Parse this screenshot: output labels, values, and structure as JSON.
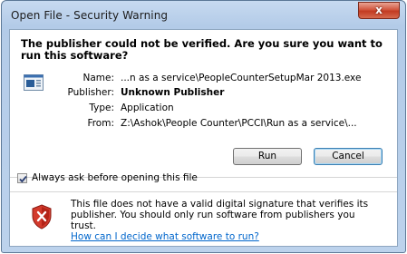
{
  "window": {
    "title": "Open File - Security Warning",
    "close_glyph": "x"
  },
  "headline": "The publisher could not be verified.  Are you sure you want to run this software?",
  "file_icon": "application-file-icon",
  "details": [
    {
      "label": "Name:",
      "value": "...n as a service\\PeopleCounterSetupMar 2013.exe",
      "bold": false
    },
    {
      "label": "Publisher:",
      "value": "Unknown Publisher",
      "bold": true
    },
    {
      "label": "Type:",
      "value": "Application",
      "bold": false
    },
    {
      "label": "From:",
      "value": "Z:\\Ashok\\People Counter\\PCCI\\Run as a service\\...",
      "bold": false
    }
  ],
  "buttons": {
    "run": "Run",
    "cancel": "Cancel"
  },
  "checkbox": {
    "label": "Always ask before opening this file",
    "checked": true
  },
  "warning": {
    "icon": "shield-warning-icon",
    "text": "This file does not have a valid digital signature that verifies its publisher.  You should only run software from publishers you trust.",
    "link": "How can I decide what software to run?"
  },
  "colors": {
    "frame": "#b3cbe8",
    "close_button": "#c23b22",
    "link": "#0066cc"
  }
}
